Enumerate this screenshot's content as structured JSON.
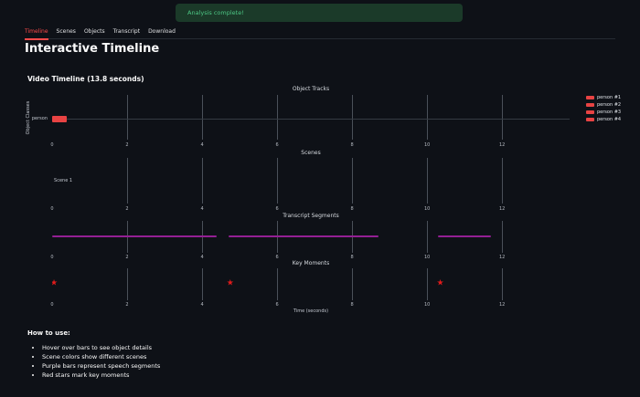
{
  "banner": {
    "message": "Analysis complete!"
  },
  "tabs": [
    {
      "label": "Timeline",
      "active": true
    },
    {
      "label": "Scenes",
      "active": false
    },
    {
      "label": "Objects",
      "active": false
    },
    {
      "label": "Transcript",
      "active": false
    },
    {
      "label": "Download",
      "active": false
    }
  ],
  "page_title": "Interactive Timeline",
  "colors": {
    "accent_red": "#ff4b4b",
    "person_bar": "#e84343",
    "transcript_bar": "#941f94",
    "key_moment_star": "#e31b1b",
    "success_text": "#4cc583",
    "success_bg": "#1b3a29"
  },
  "chart_data": {
    "type": "timeline",
    "title": "Video Timeline (13.8 seconds)",
    "duration_seconds": 13.8,
    "xlabel": "Time (seconds)",
    "x_ticks": [
      0,
      2,
      4,
      6,
      8,
      10,
      12
    ],
    "grid": true,
    "legend_position": "right",
    "legend": [
      {
        "label": "person #1",
        "color": "#e84343"
      },
      {
        "label": "person #2",
        "color": "#e84343"
      },
      {
        "label": "person #3",
        "color": "#e84343"
      },
      {
        "label": "person #4",
        "color": "#e84343"
      }
    ],
    "panels": [
      {
        "title": "Object Tracks",
        "ylabel": "Object Classes",
        "categories": [
          "person"
        ],
        "bars": [
          {
            "label": "person",
            "start": 0,
            "end": 0.4,
            "color": "#e84343"
          }
        ]
      },
      {
        "title": "Scenes",
        "annotations": [
          {
            "text": "Scene 1",
            "time": 0.05
          }
        ]
      },
      {
        "title": "Transcript Segments",
        "bars": [
          {
            "start": 0.0,
            "end": 4.4,
            "color": "#941f94"
          },
          {
            "start": 4.7,
            "end": 8.7,
            "color": "#941f94"
          },
          {
            "start": 10.3,
            "end": 11.7,
            "color": "#941f94"
          }
        ]
      },
      {
        "title": "Key Moments",
        "markers": [
          {
            "time": 0.05
          },
          {
            "time": 4.75
          },
          {
            "time": 10.35
          }
        ]
      }
    ]
  },
  "how_to_use": {
    "title": "How to use:",
    "items": [
      "Hover over bars to see object details",
      "Scene colors show different scenes",
      "Purple bars represent speech segments",
      "Red stars mark key moments"
    ]
  }
}
